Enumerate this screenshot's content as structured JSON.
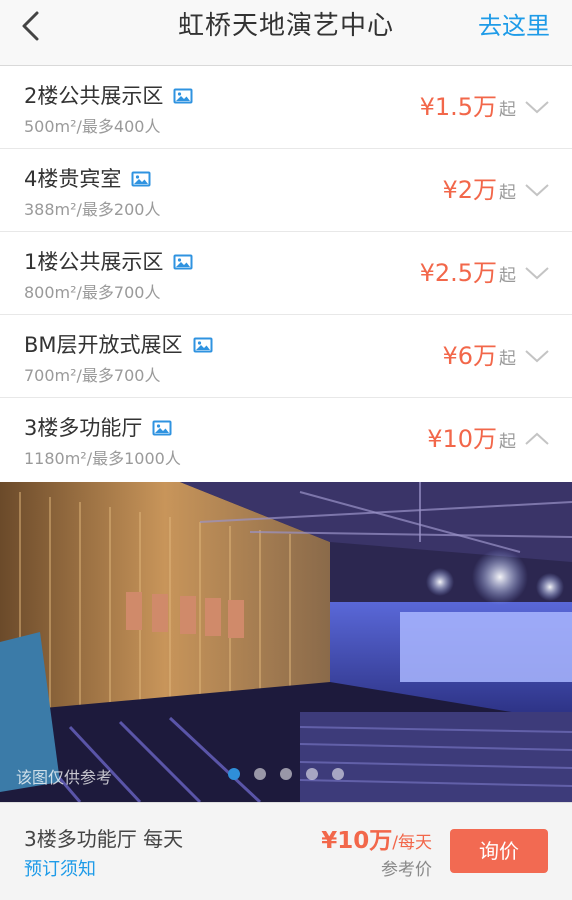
{
  "header": {
    "title": "虹桥天地演艺中心",
    "action": "去这里",
    "back_icon": "back-arrow-icon"
  },
  "venues": [
    {
      "name": "2楼公共展示区",
      "spec": "500m²/最多400人",
      "price": "¥1.5万",
      "suffix": "起",
      "expanded": false
    },
    {
      "name": "4楼贵宾室",
      "spec": "388m²/最多200人",
      "price": "¥2万",
      "suffix": "起",
      "expanded": false
    },
    {
      "name": "1楼公共展示区",
      "spec": "800m²/最多700人",
      "price": "¥2.5万",
      "suffix": "起",
      "expanded": false
    },
    {
      "name": "BM层开放式展区",
      "spec": "700m²/最多700人",
      "price": "¥6万",
      "suffix": "起",
      "expanded": false
    },
    {
      "name": "3楼多功能厅",
      "spec": "1180m²/最多1000人",
      "price": "¥10万",
      "suffix": "起",
      "expanded": true
    }
  ],
  "photo": {
    "note": "该图仅供参考",
    "slide_count": 5,
    "active_slide": 1
  },
  "footer": {
    "title": "3楼多功能厅  每天",
    "booking_link": "预订须知",
    "price": "¥10万",
    "unit": "/每天",
    "reference": "参考价",
    "inquiry_button": "询价"
  },
  "colors": {
    "accent_blue": "#1e9be8",
    "price_orange": "#f2674a",
    "button_red": "#f26a52"
  }
}
